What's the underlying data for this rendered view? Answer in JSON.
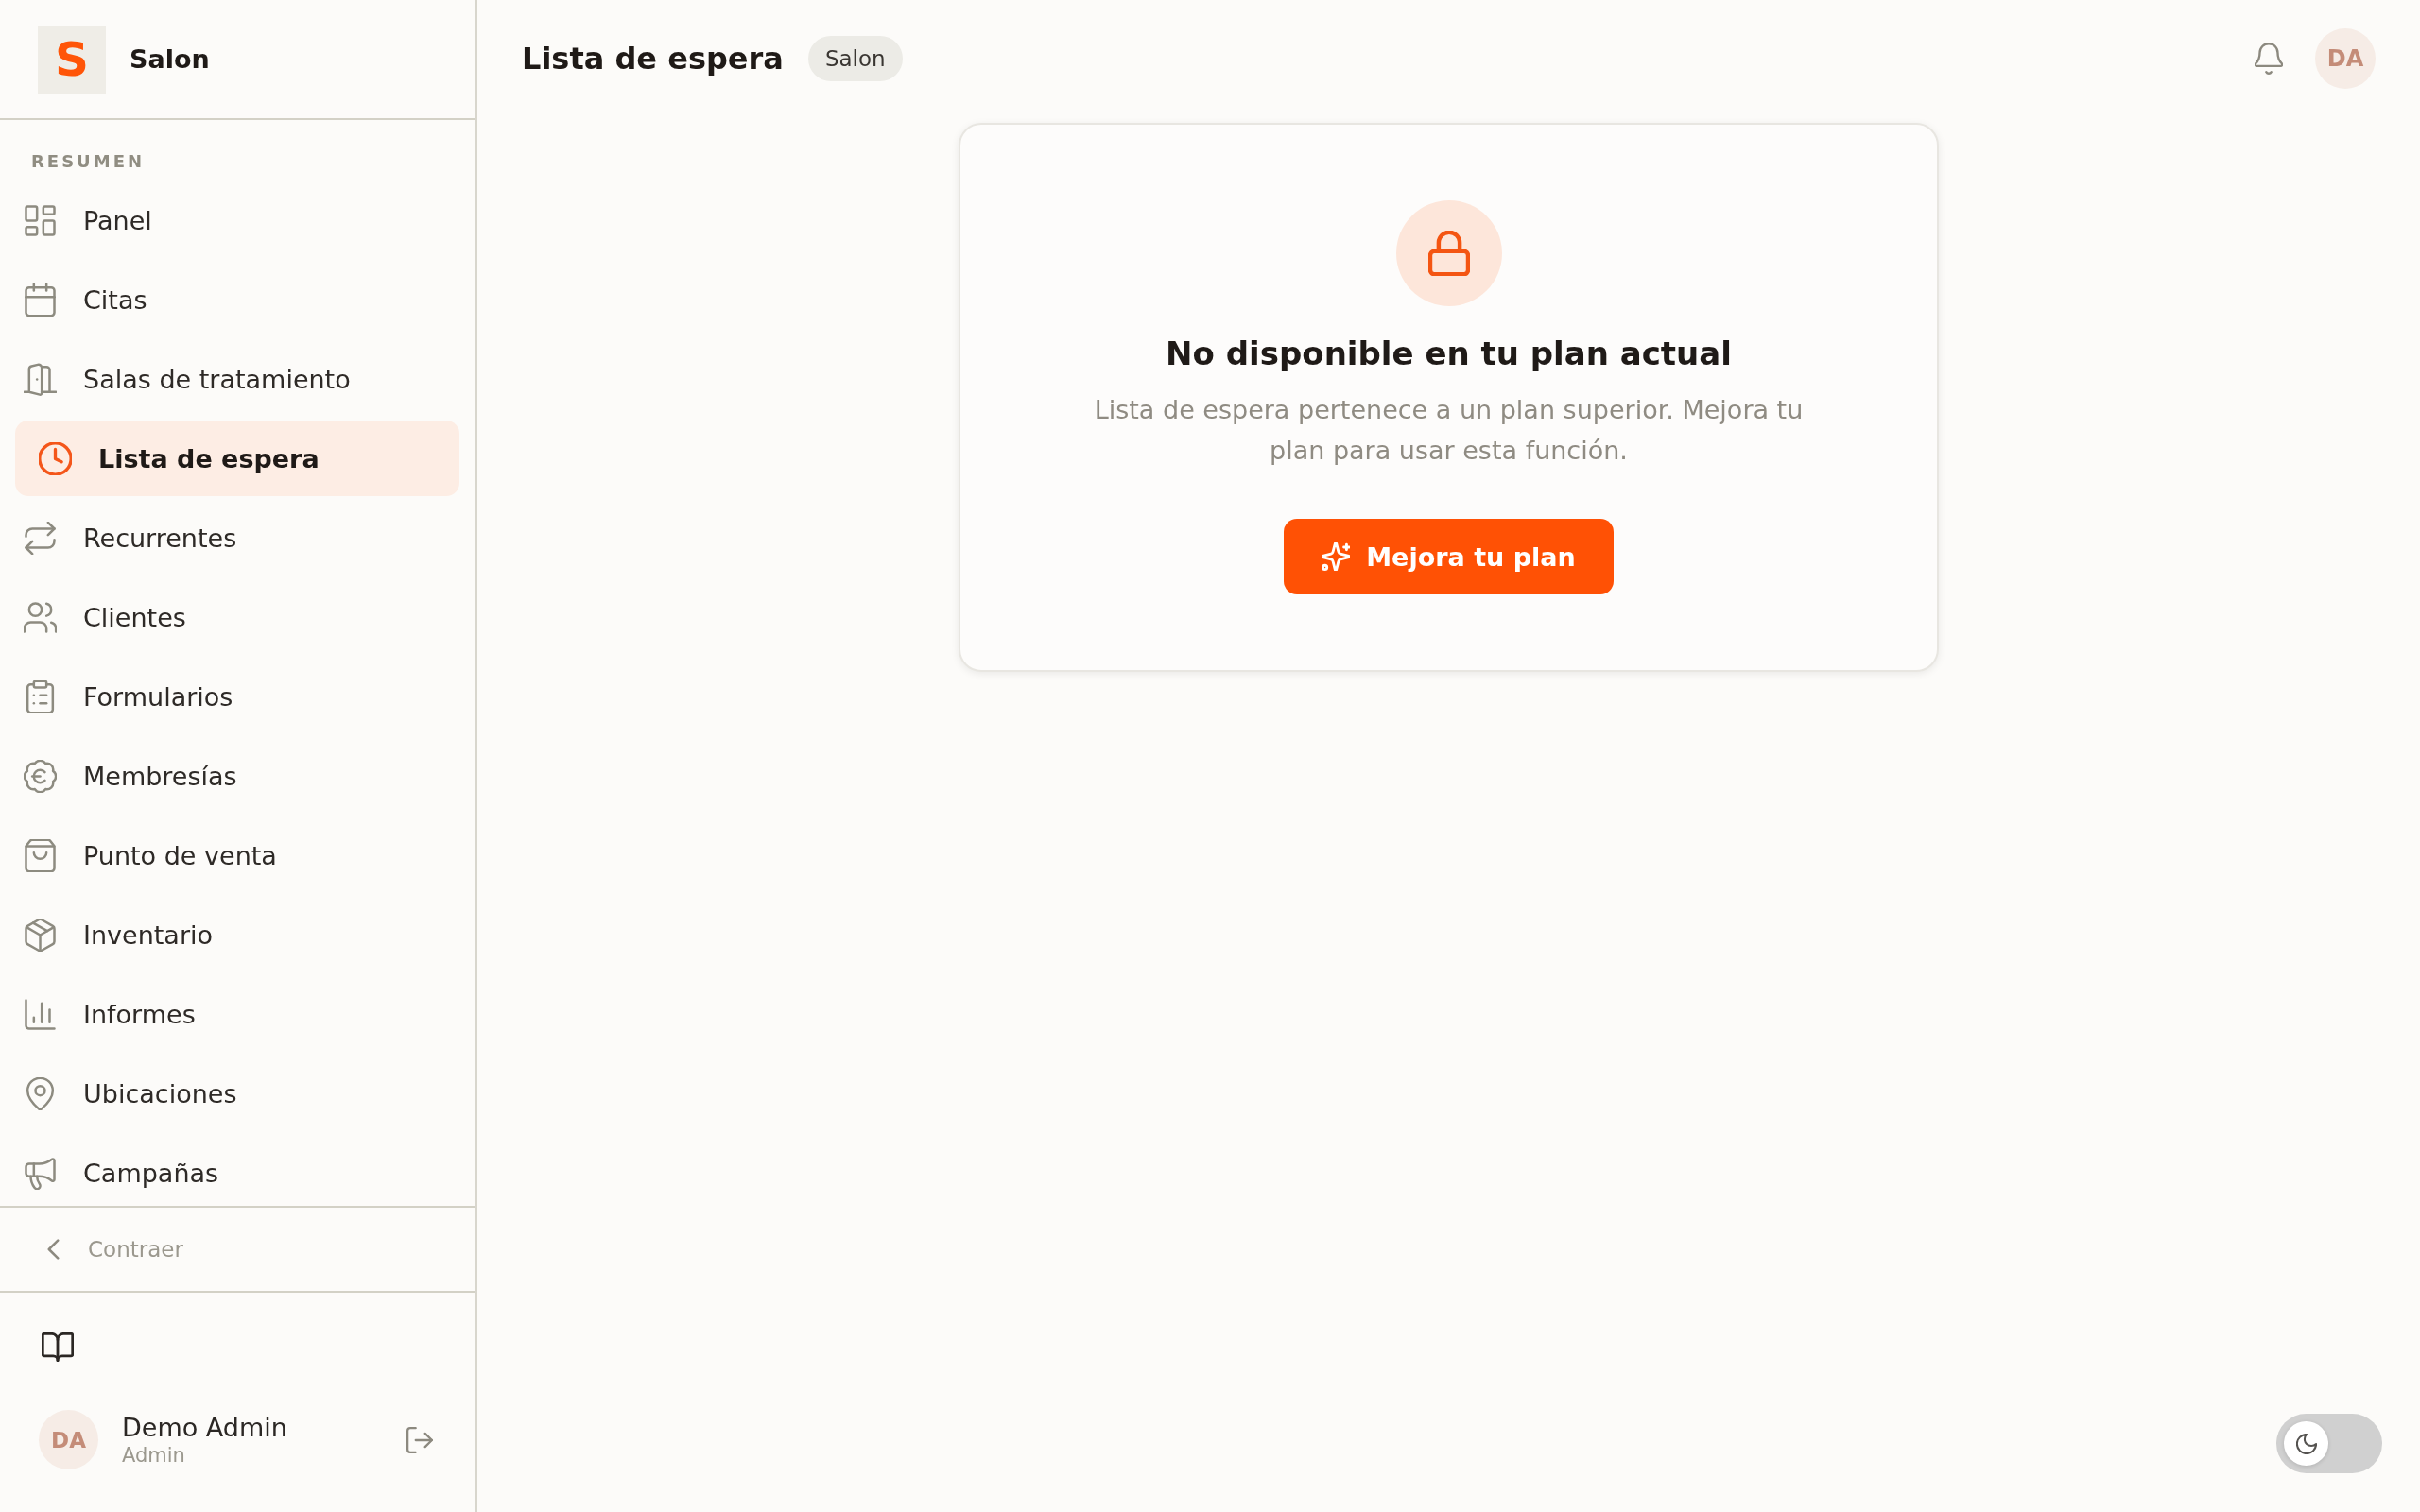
{
  "sidebar": {
    "brand": {
      "logo_letter": "S",
      "name": "Salon"
    },
    "section_label": "RESUMEN",
    "nav_items": [
      {
        "label": "Panel",
        "selected": false
      },
      {
        "label": "Citas",
        "selected": false
      },
      {
        "label": "Salas de tratamiento",
        "selected": false
      },
      {
        "label": "Lista de espera",
        "selected": true
      },
      {
        "label": "Recurrentes",
        "selected": false
      },
      {
        "label": "Clientes",
        "selected": false
      },
      {
        "label": "Formularios",
        "selected": false
      },
      {
        "label": "Membresías",
        "selected": false
      },
      {
        "label": "Punto de venta",
        "selected": false
      },
      {
        "label": "Inventario",
        "selected": false
      },
      {
        "label": "Informes",
        "selected": false
      },
      {
        "label": "Ubicaciones",
        "selected": false
      },
      {
        "label": "Campañas",
        "selected": false
      }
    ],
    "collapse": {
      "label": "Contraer"
    },
    "user": {
      "initials": "DA",
      "name": "Demo Admin",
      "role": "Admin"
    }
  },
  "header": {
    "title": "Lista de espera",
    "badge": "Salon",
    "avatar_initials": "DA"
  },
  "locked_card": {
    "title": "No disponible en tu plan actual",
    "message": "Lista de espera pertenece a un plan superior. Mejora tu plan para usar esta función.",
    "button": "Mejora tu plan"
  },
  "theme_toggle": {
    "on": false
  }
}
